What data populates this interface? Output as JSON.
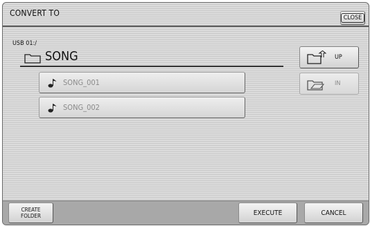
{
  "window": {
    "title": "CONVERT TO",
    "close_label": "CLOSE"
  },
  "location": {
    "path": "USB 01:/",
    "folder_name": "SONG",
    "folder_icon": "folder-icon"
  },
  "nav": {
    "up_label": "UP",
    "in_label": "IN",
    "up_icon": "folder-up-icon",
    "in_icon": "folder-in-icon",
    "in_enabled": false
  },
  "files": [
    {
      "name": "SONG_001",
      "icon": "music-note-icon"
    },
    {
      "name": "SONG_002",
      "icon": "music-note-icon"
    }
  ],
  "footer": {
    "create_folder_line1": "CREATE",
    "create_folder_line2": "FOLDER",
    "execute_label": "EXECUTE",
    "cancel_label": "CANCEL"
  }
}
